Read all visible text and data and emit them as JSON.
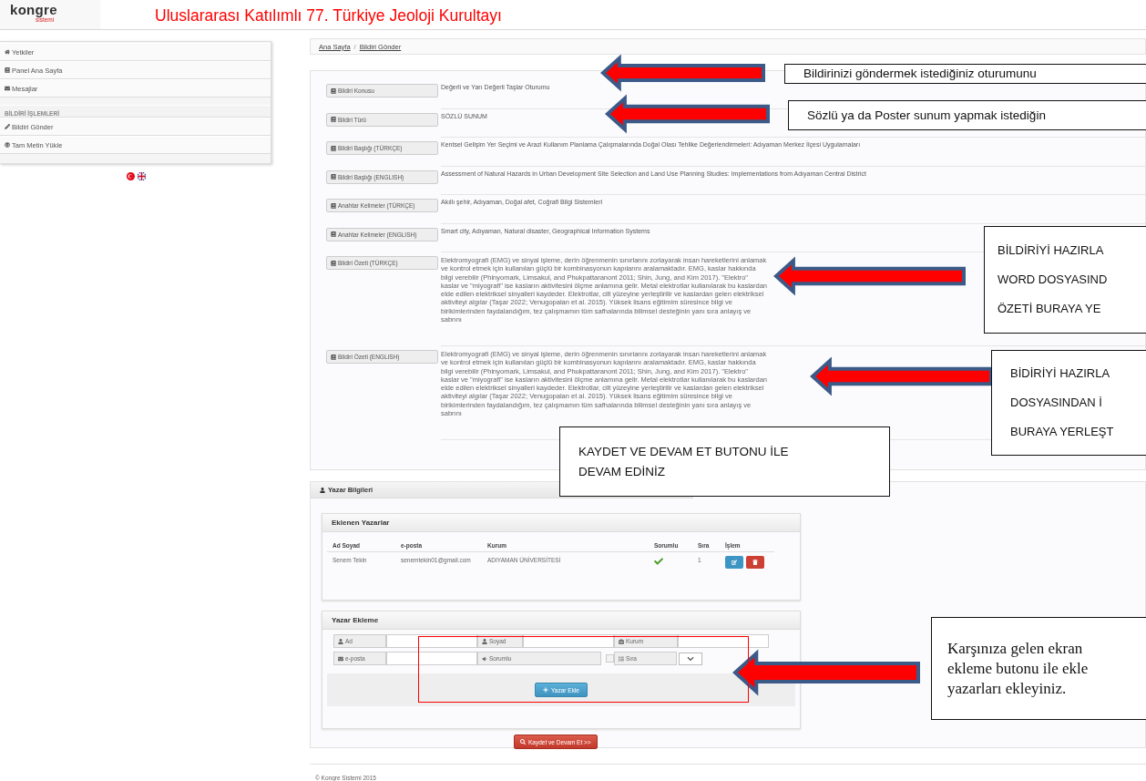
{
  "header": {
    "logo": "kongre",
    "logo_sub": "sistemi",
    "title": "Uluslararası Katılımlı 77. Türkiye Jeoloji Kurultayı"
  },
  "sidebar": {
    "items": [
      {
        "kind": "link",
        "label": "Yetkiler"
      },
      {
        "kind": "link",
        "label": "Panel Ana Sayfa"
      },
      {
        "kind": "link",
        "label": "Mesajlar"
      },
      {
        "kind": "heading",
        "label": "BİLDİRİ İŞLEMLERİ"
      },
      {
        "kind": "link",
        "label": "Bildiri Gönder"
      },
      {
        "kind": "link",
        "label": "Tam Metin Yükle"
      }
    ]
  },
  "breadcrumb": [
    "Ana Sayfa",
    "Bildiri Gönder"
  ],
  "breadcrumb_separator": "/",
  "form": {
    "rows": [
      {
        "kind": "text",
        "label": "Bildiri Konusu",
        "value": "Değerli ve Yarı Değerli Taşlar Oturumu"
      },
      {
        "kind": "text",
        "label": "Bildiri Türü",
        "value": "SÖZLÜ SUNUM"
      },
      {
        "kind": "text",
        "label": "Bildiri Başlığı (TÜRKÇE)",
        "value": "Kentsel Gelişim Yer Seçimi ve Arazi Kullanım Planlama Çalışmalarında Doğal Olası Tehlike Değerlendirmeleri: Adıyaman Merkez İlçesi Uygulamaları"
      },
      {
        "kind": "text",
        "label": "Bildiri Başlığı (ENGLISH)",
        "value": "Assessment of Natural Hazards in Urban Development Site Selection and Land Use Planning Studies: Implementations from Adıyaman Central District"
      },
      {
        "kind": "text",
        "label": "Anahtar Kelimeler (TÜRKÇE)",
        "value": "Akıllı şehir, Adıyaman, Doğal afet, Coğrafi Bilgi Sistemleri"
      },
      {
        "kind": "text",
        "label": "Anahtar Kelimeler (ENGLISH)",
        "value": "Smart city, Adıyaman, Natural disaster, Geographical Information Systems"
      },
      {
        "kind": "abstract",
        "label": "Bildiri Özeti (TÜRKÇE)",
        "value": "Elektromyografi (EMG) ve sinyal işleme, derin öğrenmenin sınırlarını zorlayarak insan hareketlerini anlamak ve kontrol etmek için kullanılan güçlü bir kombinasyonun kapılarını aralamaktadır. EMG, kaslar hakkında bilgi verebilir (Phinyomark, Limsakul, and Phukpattaranont 2011; Shin, Jung, and Kim 2017). \"Elektro\" kaslar ve \"miyografi\" ise kasların aktivitesini ölçme anlamına gelir. Metal elektrotlar kullanılarak bu kaslardan elde edilen elektriksel sinyalleri kaydeder. Elektrotlar, cilt yüzeyine yerleştirilir ve kaslardan gelen elektriksel aktiviteyi algılar (Taşar 2022; Venugopalan et al. 2015). Yüksek lisans eğitimim süresince bilgi ve birikimlerinden faydalandığım, tez çalışmamın tüm safhalarında bilimsel desteğinin yanı sıra anlayış ve sabrını"
      },
      {
        "kind": "abstract",
        "label": "Bildiri Özeti (ENGLISH)",
        "value": "Elektromyografi (EMG) ve sinyal işleme, derin öğrenmenin sınırlarını zorlayarak insan hareketlerini anlamak ve kontrol etmek için kullanılan güçlü bir kombinasyonun kapılarını aralamaktadır. EMG, kaslar hakkında bilgi verebilir (Phinyomark, Limsakul, and Phukpattaranont 2011; Shin, Jung, and Kim 2017). \"Elektro\" kaslar ve \"miyografi\" ise kasların aktivitesini ölçme anlamına gelir. Metal elektrotlar kullanılarak bu kaslardan elde edilen elektriksel sinyalleri kaydeder. Elektrotlar, cilt yüzeyine yerleştirilir ve kaslardan gelen elektriksel aktiviteyi algılar (Taşar 2022; Venugopalan et al. 2015). Yüksek lisans eğitimim süresince bilgi ve birikimlerinden faydalandığım, tez çalışmamın tüm safhalarında bilimsel desteğinin yanı sıra anlayış ve sabrını"
      }
    ]
  },
  "authors": {
    "title": "Yazar Bilgileri",
    "added": {
      "title": "Eklenen Yazarlar",
      "columns": [
        "Ad Soyad",
        "e-posta",
        "Kurum",
        "Sorumlu",
        "Sıra",
        "İşlem"
      ],
      "rows": [
        {
          "name": "Senem Tekin",
          "email": "senemtekin01@gmail.com",
          "institution": "ADIYAMAN ÜNİVERSİTESİ",
          "responsible": true,
          "order": "1"
        }
      ]
    },
    "add": {
      "title": "Yazar Ekleme",
      "fields": [
        {
          "kind": "text",
          "label": "Ad"
        },
        {
          "kind": "text",
          "label": "Soyad"
        },
        {
          "kind": "text",
          "label": "Kurum"
        },
        {
          "kind": "text",
          "label": "e-posta"
        },
        {
          "kind": "checkbox",
          "label": "Sorumlu",
          "checked": false
        },
        {
          "kind": "select",
          "label": "Sıra"
        }
      ],
      "button": "Yazar Ekle"
    },
    "submit": "Kaydet ve Devam Et >>"
  },
  "footer": "© Kongre Sistemi 2015",
  "callouts": [
    {
      "lines": [
        "Bildirinizi göndermek istediğiniz oturumunu"
      ]
    },
    {
      "lines": [
        "Sözlü ya da Poster sunum yapmak istediğin"
      ]
    },
    {
      "lines": [
        "BİLDİRİYİ HAZIRLA",
        "WORD DOSYASIND",
        "ÖZETİ BURAYA YE"
      ]
    },
    {
      "lines": [
        "BİDİRİYİ HAZIRLA",
        "DOSYASINDAN İ",
        "BURAYA YERLEŞT"
      ]
    },
    {
      "lines": [
        "KAYDET VE DEVAM ET  BUTONU İLE",
        "DEVAM EDİNİZ"
      ]
    },
    {
      "lines": [
        "Karşınıza gelen ekran",
        "ekleme butonu ile ekle",
        "yazarları ekleyiniz."
      ]
    }
  ]
}
